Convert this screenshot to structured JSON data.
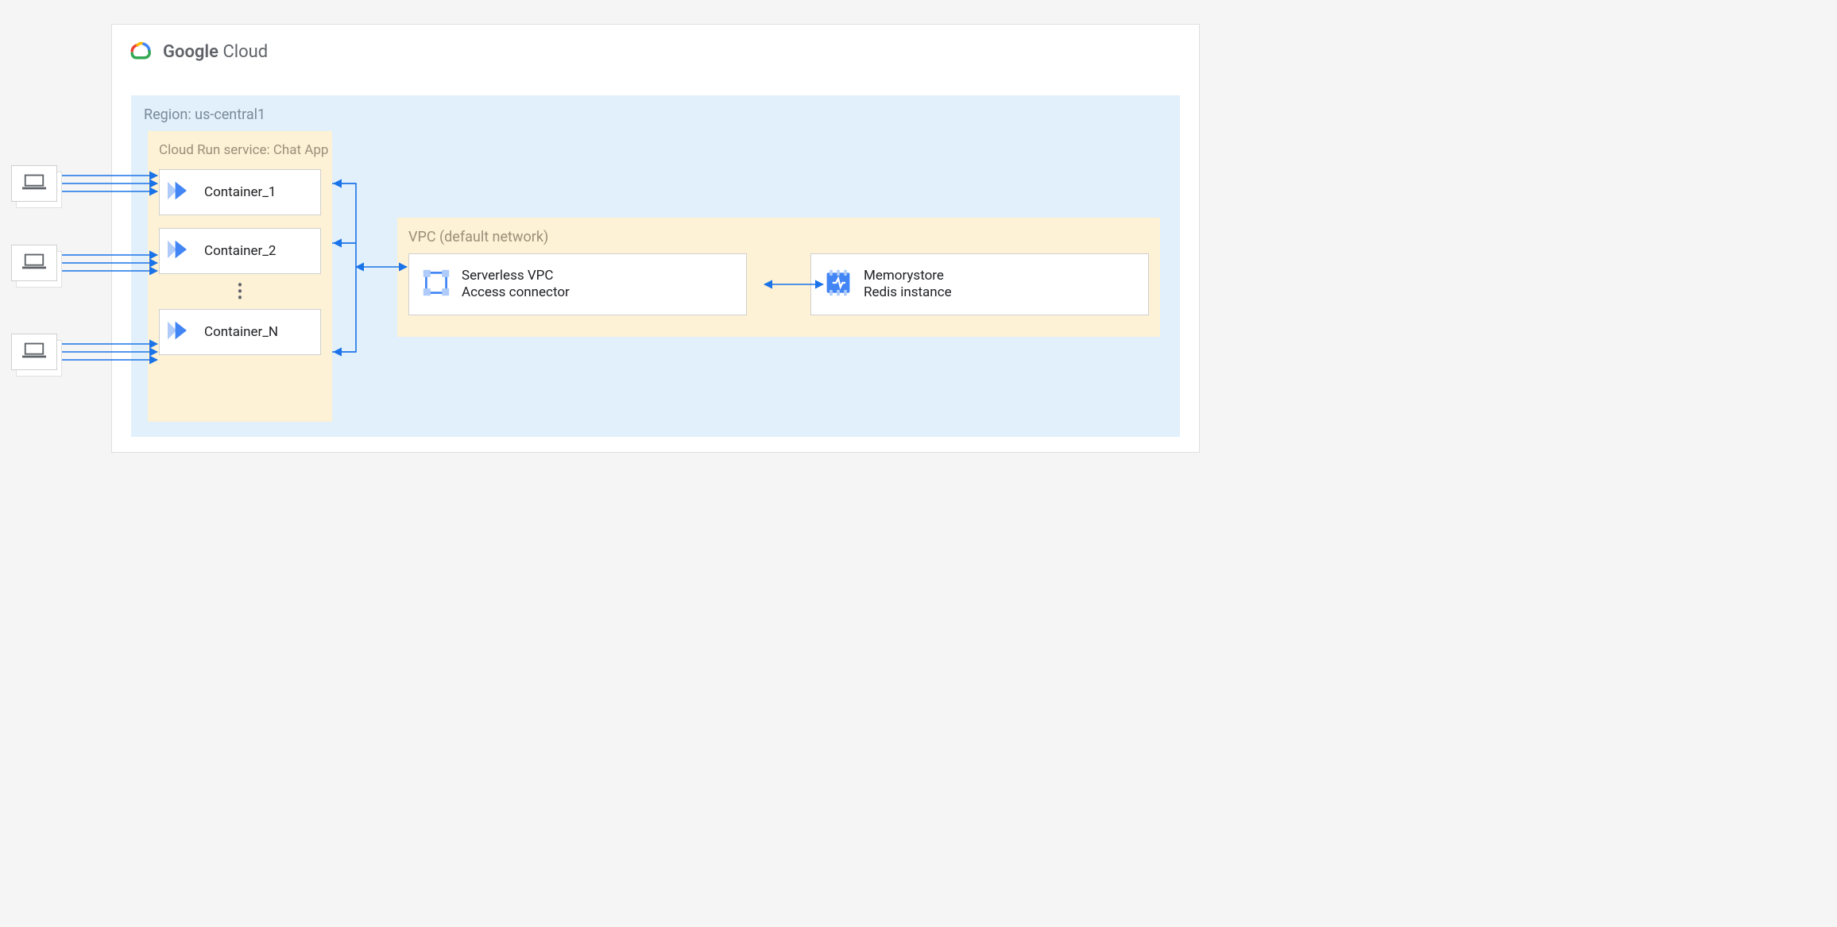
{
  "brand": {
    "name_bold": "Google",
    "name_light": "Cloud"
  },
  "region": {
    "label": "Region: us-central1"
  },
  "cloud_run": {
    "label": "Cloud Run service: Chat App",
    "containers": [
      {
        "name": "Container_1"
      },
      {
        "name": "Container_2"
      },
      {
        "name": "Container_N"
      }
    ]
  },
  "vpc": {
    "label": "VPC (default network)",
    "connector": {
      "line1": "Serverless VPC",
      "line2": "Access connector"
    },
    "memorystore": {
      "line1": "Memorystore",
      "line2": "Redis instance"
    }
  },
  "colors": {
    "accent": "#1a73e8",
    "region_bg": "#e1f0fb",
    "group_bg": "#fdf1d6"
  }
}
